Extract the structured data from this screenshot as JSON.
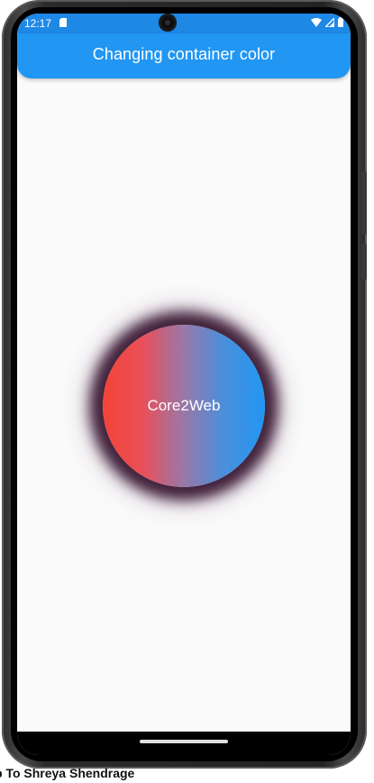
{
  "status_bar": {
    "time": "12:17",
    "icons": [
      "sd-card-icon",
      "wifi-icon",
      "cell-signal-icon",
      "battery-icon"
    ]
  },
  "app_bar": {
    "title": "Changing container color",
    "color": "#2196f3"
  },
  "container": {
    "label": "Core2Web",
    "gradient_colors": [
      "#f44336",
      "#2196f3"
    ],
    "glow_color": "#42233c"
  },
  "caption": {
    "text": "p To Shreya Shendrage"
  }
}
